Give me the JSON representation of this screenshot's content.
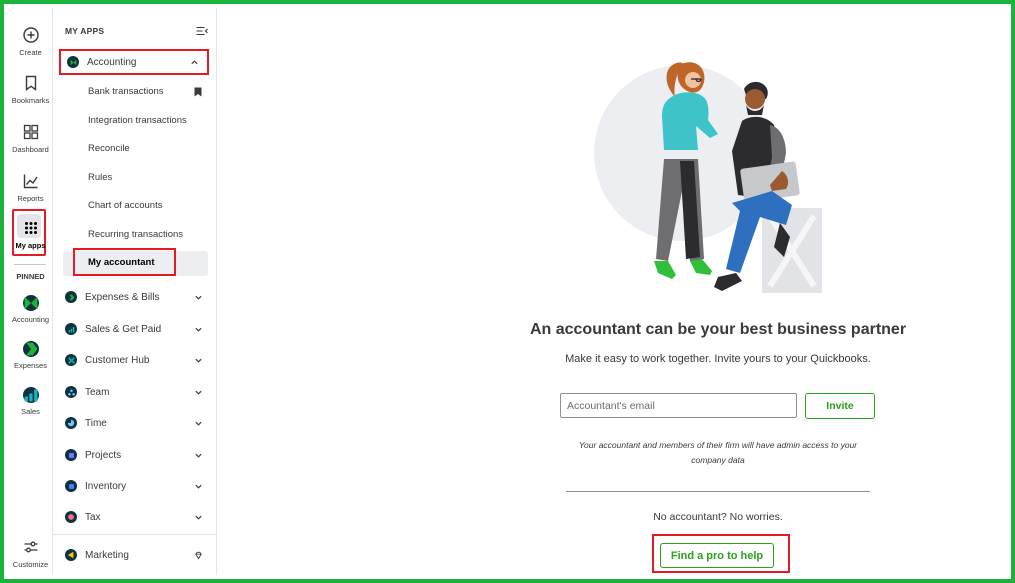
{
  "rail": {
    "create": "Create",
    "bookmarks": "Bookmarks",
    "dashboard": "Dashboard",
    "reports": "Reports",
    "my_apps": "My apps",
    "pinned": "PINNED",
    "accounting": "Accounting",
    "expenses": "Expenses",
    "sales": "Sales",
    "customize": "Customize"
  },
  "apps": {
    "header": "MY APPS",
    "accounting": "Accounting",
    "accounting_items": [
      "Bank transactions",
      "Integration transactions",
      "Reconcile",
      "Rules",
      "Chart of accounts",
      "Recurring transactions",
      "My accountant"
    ],
    "list": [
      {
        "label": "Expenses & Bills",
        "color": "#1db33a"
      },
      {
        "label": "Sales & Get Paid",
        "color": "#13b6c9"
      },
      {
        "label": "Customer Hub",
        "color": "#00b4b1"
      },
      {
        "label": "Team",
        "color": "#0077c5"
      },
      {
        "label": "Time",
        "color": "#0077c5"
      },
      {
        "label": "Projects",
        "color": "#4a5bd4"
      },
      {
        "label": "Inventory",
        "color": "#2552b8"
      },
      {
        "label": "Tax",
        "color": "#e05a78"
      }
    ],
    "marketing": "Marketing"
  },
  "main": {
    "headline": "An accountant can be your best business partner",
    "subline": "Make it easy to work together. Invite yours to your Quickbooks.",
    "email_placeholder": "Accountant's email",
    "invite": "Invite",
    "note": "Your accountant and members of their firm will have admin access to your company data",
    "no_accountant": "No accountant? No worries.",
    "find_pro": "Find a pro to help"
  },
  "colors": {
    "brand_green": "#2ca01c",
    "highlight_red": "#e31b23",
    "frame_green": "#1db33a",
    "navy": "#0d333f"
  }
}
